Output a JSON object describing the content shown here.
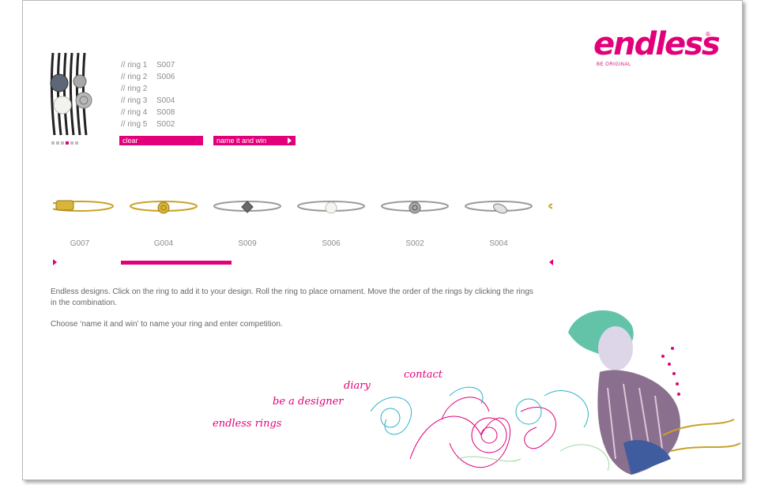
{
  "brand": {
    "logo": "endless",
    "tagline": "BE ORIGINAL",
    "registered": "®",
    "color": "#e2007a"
  },
  "preview": {
    "dots_total": 6,
    "active_dot": 4
  },
  "rings": [
    {
      "label": "// ring 1",
      "code": "S007"
    },
    {
      "label": "// ring 2",
      "code": "S006"
    },
    {
      "label": "// ring 2",
      "code": ""
    },
    {
      "label": "// ring 3",
      "code": "S004"
    },
    {
      "label": "// ring 4",
      "code": "S008"
    },
    {
      "label": "// ring 5",
      "code": "S002"
    }
  ],
  "buttons": {
    "clear": "clear",
    "name_it": "name it and win"
  },
  "carousel": {
    "items": [
      {
        "code": "G007",
        "metal": "gold",
        "ornament": "bow"
      },
      {
        "code": "G004",
        "metal": "gold",
        "ornament": "rose"
      },
      {
        "code": "S009",
        "metal": "silver",
        "ornament": "square-stone"
      },
      {
        "code": "S006",
        "metal": "silver",
        "ornament": "pearl"
      },
      {
        "code": "S002",
        "metal": "silver",
        "ornament": "rose"
      },
      {
        "code": "S004",
        "metal": "silver",
        "ornament": "marquise-stone"
      }
    ]
  },
  "description": {
    "line1": "Endless designs. Click on the ring to add it to your design. Roll the ring to place ornament. Move the order of the rings by clicking the rings in the combination.",
    "line2": "Choose ‘name it and win’ to name your ring and enter competition."
  },
  "nav": {
    "endless_rings": "endless rings",
    "be_a_designer": "be a designer",
    "diary": "diary",
    "contact": "contact"
  }
}
